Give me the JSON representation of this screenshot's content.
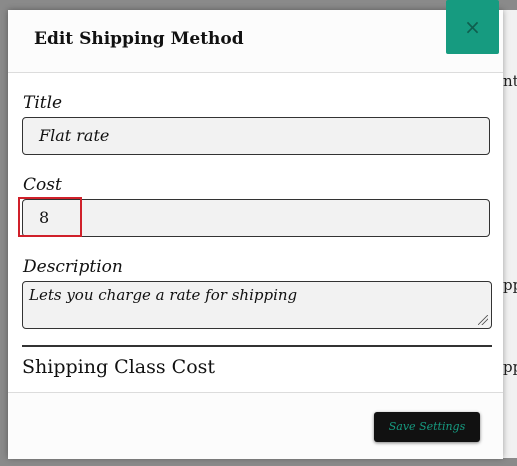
{
  "modal": {
    "title": "Edit Shipping Method",
    "close_label": "×"
  },
  "fields": {
    "title_label": "Title",
    "title_value": "Flat rate",
    "cost_label": "Cost",
    "cost_value": "8",
    "description_label": "Description",
    "description_value": "Lets you charge a rate for shipping"
  },
  "section": {
    "shipping_class_title": "Shipping Class Cost"
  },
  "footer": {
    "save_label": "Save Settings"
  },
  "background": {
    "fragment_1": "nt",
    "fragment_2": "pp",
    "fragment_3": "pp"
  },
  "colors": {
    "accent": "#169b80",
    "highlight": "#d0202a"
  }
}
